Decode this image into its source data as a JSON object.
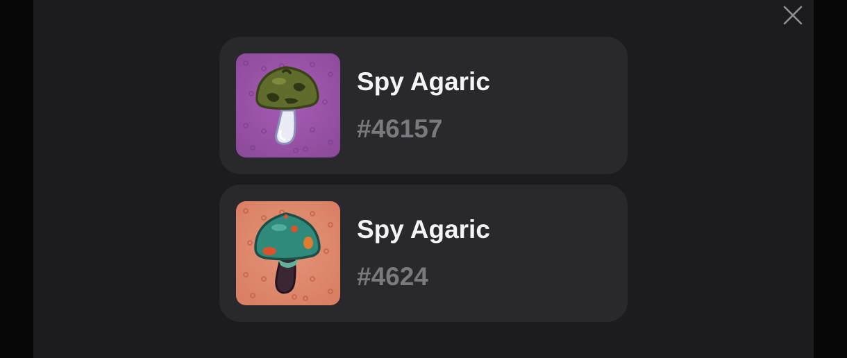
{
  "modal": {
    "close_icon": "close-icon",
    "items": [
      {
        "name": "Spy Agaric",
        "id": "#46157",
        "image_icon": "camo-mushroom-icon",
        "background_color": "#9a52a8",
        "cap_color": "#5e6b2c",
        "stem_color": "#e8eaf4"
      },
      {
        "name": "Spy Agaric",
        "id": "#4624",
        "image_icon": "teal-mushroom-icon",
        "background_color": "#df8a6e",
        "cap_color": "#2f8a7c",
        "stem_color": "#3b2634"
      }
    ]
  }
}
